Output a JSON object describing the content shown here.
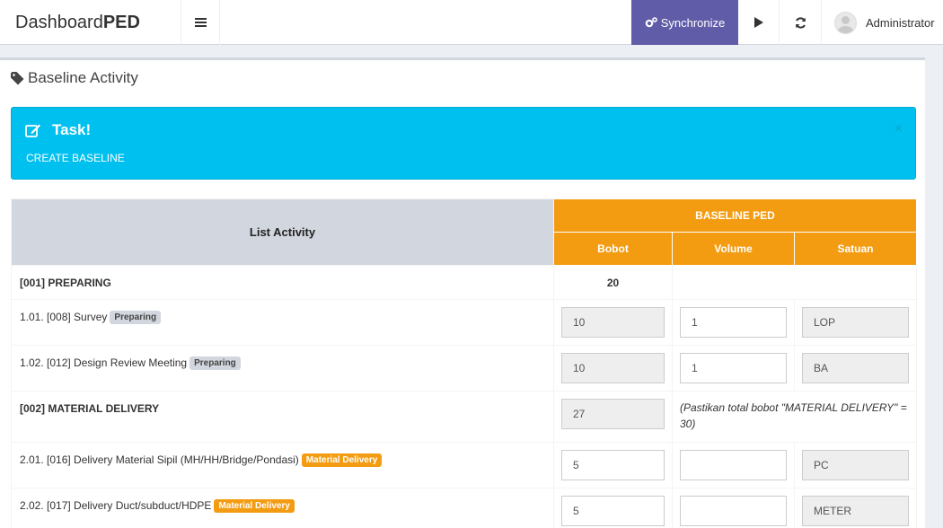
{
  "header": {
    "logo_light": "Dashboard",
    "logo_bold": "PED",
    "sync_label": "Synchronize",
    "user_name": "Administrator"
  },
  "page": {
    "title": "Baseline Activity"
  },
  "alert": {
    "title": "Task!",
    "text": "CREATE BASELINE",
    "close": "×"
  },
  "table": {
    "col_activity": "List Activity",
    "group_header": "BASELINE PED",
    "col_bobot": "Bobot",
    "col_volume": "Volume",
    "col_satuan": "Satuan",
    "categories": [
      {
        "label": "[001] PREPARING",
        "bobot": "20"
      },
      {
        "label": "[002] MATERIAL DELIVERY",
        "bobot": "27",
        "warning": "(Pastikan total bobot \"MATERIAL DELIVERY\" = 30)"
      }
    ],
    "rows": [
      {
        "name": "1.01. [008] Survey",
        "badge": "Preparing",
        "bobot": "10",
        "volume": "1",
        "satuan": "LOP"
      },
      {
        "name": "1.02. [012] Design Review Meeting",
        "badge": "Preparing",
        "bobot": "10",
        "volume": "1",
        "satuan": "BA"
      },
      {
        "name": "2.01. [016] Delivery Material Sipil (MH/HH/Bridge/Pondasi)",
        "badge": "Material Delivery",
        "bobot": "5",
        "volume": "",
        "satuan": "PC"
      },
      {
        "name": "2.02. [017] Delivery Duct/subduct/HDPE",
        "badge": "Material Delivery",
        "bobot": "5",
        "volume": "",
        "satuan": "METER"
      }
    ]
  },
  "colors": {
    "accent_purple": "#605ca8",
    "info_blue": "#00c0ef",
    "orange": "#f39c12",
    "warning_red": "#dd4b39"
  }
}
